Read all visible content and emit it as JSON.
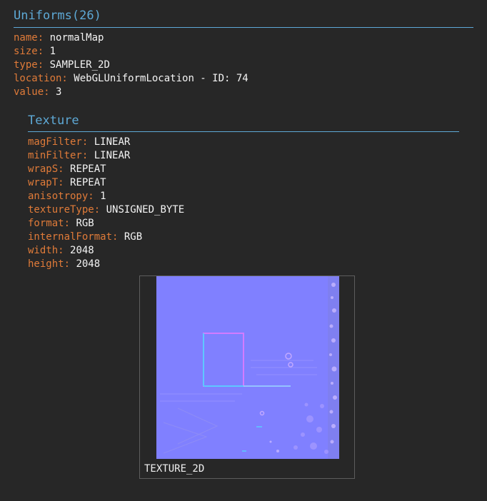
{
  "uniforms": {
    "title": "Uniforms(26)",
    "props": [
      {
        "key": "name:",
        "value": "normalMap"
      },
      {
        "key": "size:",
        "value": "1"
      },
      {
        "key": "type:",
        "value": "SAMPLER_2D"
      },
      {
        "key": "location:",
        "value": "WebGLUniformLocation - ID: 74"
      },
      {
        "key": "value:",
        "value": "3"
      }
    ]
  },
  "texture": {
    "title": "Texture",
    "props": [
      {
        "key": "magFilter:",
        "value": "LINEAR"
      },
      {
        "key": "minFilter:",
        "value": "LINEAR"
      },
      {
        "key": "wrapS:",
        "value": "REPEAT"
      },
      {
        "key": "wrapT:",
        "value": "REPEAT"
      },
      {
        "key": "anisotropy:",
        "value": "1"
      },
      {
        "key": "textureType:",
        "value": "UNSIGNED_BYTE"
      },
      {
        "key": "format:",
        "value": "RGB"
      },
      {
        "key": "internalFormat:",
        "value": "RGB"
      },
      {
        "key": "width:",
        "value": "2048"
      },
      {
        "key": "height:",
        "value": "2048"
      }
    ],
    "preview_label": "TEXTURE_2D",
    "preview_base_color": "#8080ff"
  },
  "colors": {
    "background": "#272727",
    "accent": "#5ea9d6",
    "key": "#e07b39",
    "value": "#f4f4f4"
  }
}
